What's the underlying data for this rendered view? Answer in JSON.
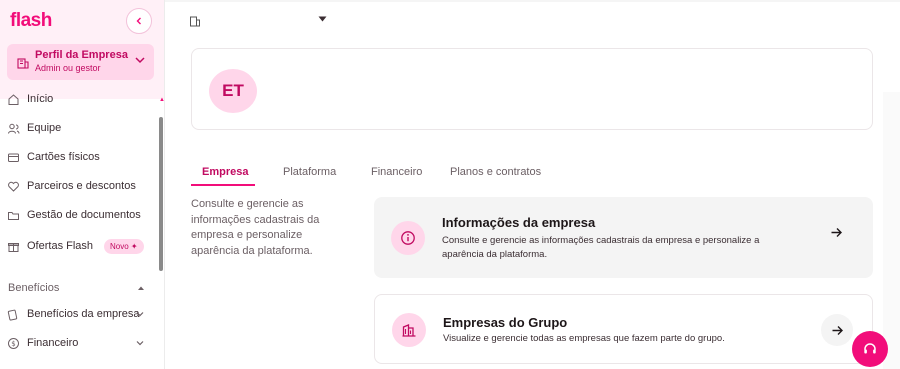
{
  "brand": {
    "logo": "flash",
    "accent": "#f20d7a",
    "accent_dark": "#c10a61",
    "accent_light": "#ffd6ea"
  },
  "sidebar": {
    "collapse_icon": "chevron-left-icon",
    "profile": {
      "title": "Perfil da Empresa",
      "subtitle": "Admin ou gestor",
      "icon": "building-icon"
    },
    "items": [
      {
        "label": "Início",
        "icon": "home-icon"
      },
      {
        "label": "Equipe",
        "icon": "people-icon"
      },
      {
        "label": "Cartões físicos",
        "icon": "card-icon"
      },
      {
        "label": "Parceiros e descontos",
        "icon": "heart-handshake-icon"
      },
      {
        "label": "Gestão de documentos",
        "icon": "folder-icon"
      },
      {
        "label": "Ofertas Flash",
        "icon": "gift-icon",
        "badge": "Novo ✦"
      }
    ],
    "section": "Benefícios",
    "section_items": [
      {
        "label": "Benefícios da empresa",
        "icon": "benefits-icon"
      },
      {
        "label": "Financeiro",
        "icon": "dollar-icon"
      }
    ]
  },
  "header": {
    "avatar_initials": "ET"
  },
  "tabs": [
    {
      "label": "Empresa",
      "active": true
    },
    {
      "label": "Plataforma",
      "active": false
    },
    {
      "label": "Financeiro",
      "active": false
    },
    {
      "label": "Planos e contratos",
      "active": false
    }
  ],
  "main": {
    "description": "Consulte e gerencie as informações cadastrais da empresa e personalize aparência da plataforma.",
    "cards": [
      {
        "title": "Informações da empresa",
        "subtitle": "Consulte e gerencie as informações cadastrais da empresa e personalize a aparência da plataforma.",
        "icon": "info-icon"
      },
      {
        "title": "Empresas do Grupo",
        "subtitle": "Visualize e gerencie todas as empresas que fazem parte do grupo.",
        "icon": "buildings-icon"
      }
    ]
  },
  "help": {
    "icon": "headset-icon"
  }
}
